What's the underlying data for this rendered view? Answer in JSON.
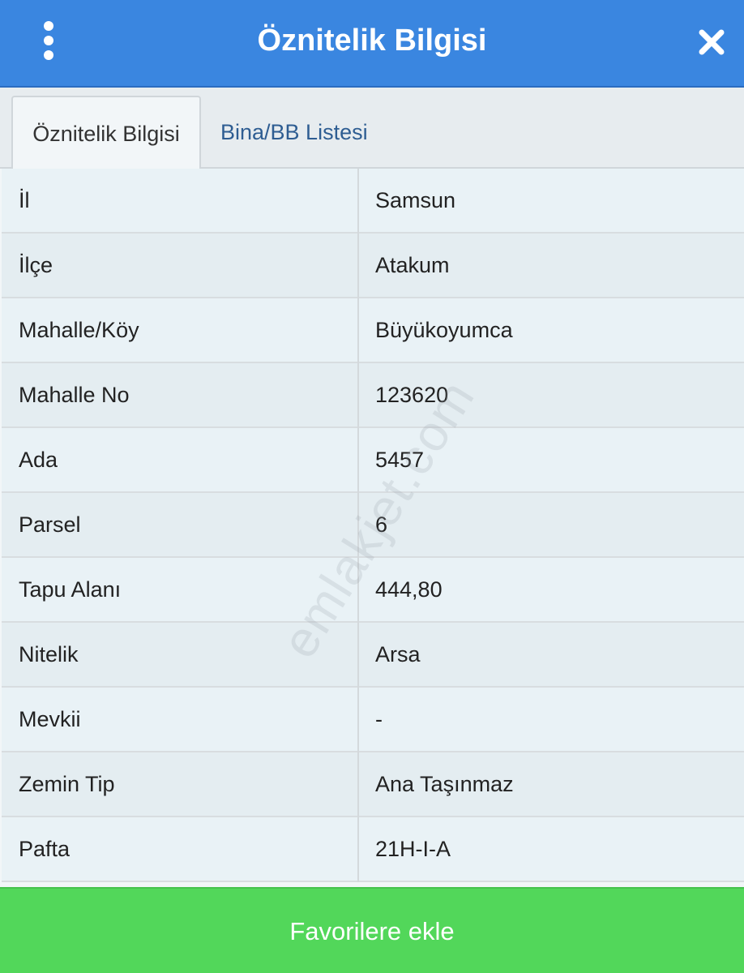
{
  "header": {
    "title": "Öznitelik Bilgisi",
    "menu_icon": "more-vertical-icon",
    "close_icon": "close-icon",
    "background_color": "#3a86e0"
  },
  "tabs": [
    {
      "label": "Öznitelik Bilgisi",
      "active": true
    },
    {
      "label": "Bina/BB Listesi",
      "active": false
    }
  ],
  "attributes": [
    {
      "label": "İl",
      "value": "Samsun"
    },
    {
      "label": "İlçe",
      "value": "Atakum"
    },
    {
      "label": "Mahalle/Köy",
      "value": "Büyükoyumca"
    },
    {
      "label": "Mahalle No",
      "value": "123620"
    },
    {
      "label": "Ada",
      "value": "5457"
    },
    {
      "label": "Parsel",
      "value": "6"
    },
    {
      "label": "Tapu Alanı",
      "value": "444,80"
    },
    {
      "label": "Nitelik",
      "value": "Arsa"
    },
    {
      "label": "Mevkii",
      "value": "-"
    },
    {
      "label": "Zemin Tip",
      "value": "Ana Taşınmaz"
    },
    {
      "label": "Pafta",
      "value": "21H-I-A"
    }
  ],
  "watermark": "emlakjet.com",
  "footer": {
    "favorite_button_label": "Favorilere ekle",
    "button_color": "#52d75a"
  }
}
